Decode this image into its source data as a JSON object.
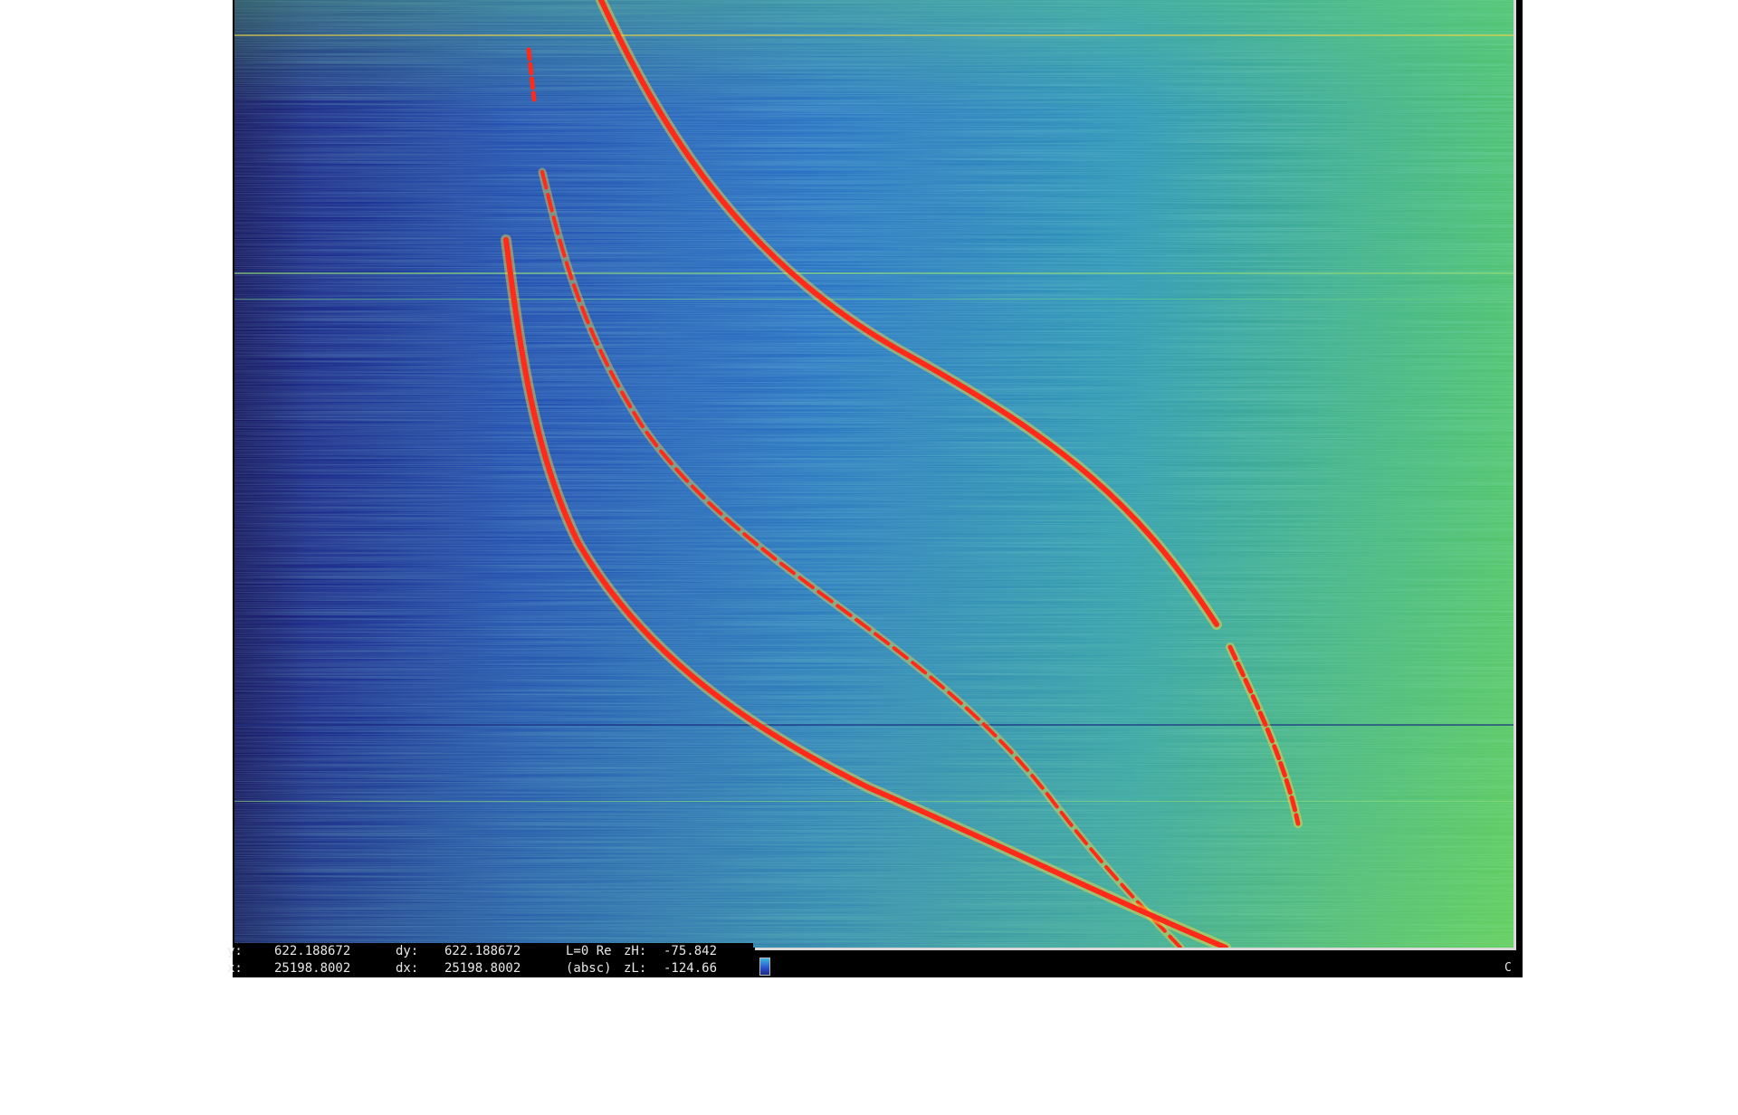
{
  "status": {
    "row1": {
      "y_label": "y:",
      "y_value": "622.188672",
      "dy_label": "dy:",
      "dy_value": "622.188672",
      "mode": "L=0 Re",
      "zh_label": "zH:",
      "zh_value": "-75.842"
    },
    "row2": {
      "x_label": "x:",
      "x_value": "25198.8002",
      "dx_label": "dx:",
      "dx_value": "25198.8002",
      "mode": "(absc)",
      "zl_label": "zL:",
      "zl_value": "-124.66"
    },
    "corner_label": "C"
  },
  "colormap": {
    "low": "#16125e",
    "mid": "#2f7fd0",
    "high_mid": "#3fc7a0",
    "high": "#7fe04a",
    "trace": "#ff2a1a",
    "trace_edge": "#ffd93a"
  }
}
